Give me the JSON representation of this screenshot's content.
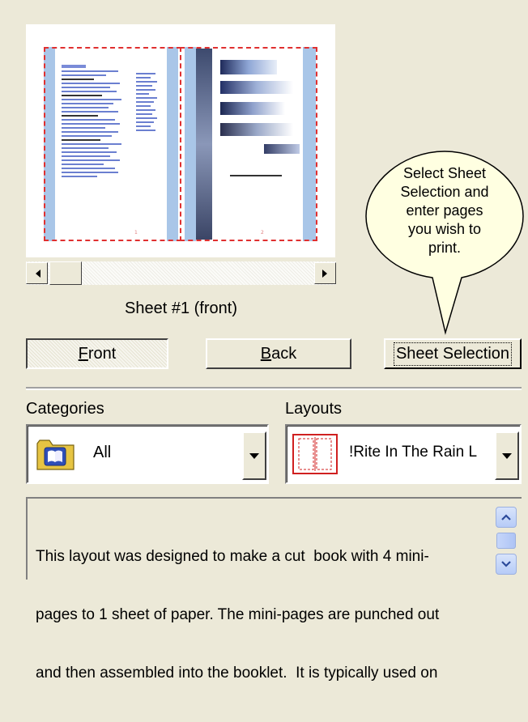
{
  "preview": {
    "left_page_number": "1",
    "right_page_number": "2"
  },
  "sheet_label": "Sheet #1 (front)",
  "buttons": {
    "front_label": "Front",
    "front_accel": "F",
    "front_rest": "ront",
    "back_label": "Back",
    "back_accel": "B",
    "back_rest": "ack",
    "sheet_selection_label": "Sheet Selection"
  },
  "tooltip": {
    "lines": [
      "Select Sheet",
      "Selection and",
      "enter pages",
      "you wish to",
      "print."
    ]
  },
  "categories": {
    "label": "Categories",
    "selected": "All",
    "icon": "book-folder-icon"
  },
  "layouts": {
    "label": "Layouts",
    "selected": "!Rite In The Rain L",
    "icon": "booklet-layout-icon"
  },
  "description": {
    "lines": [
      "This layout was designed to make a cut  book with 4 mini-",
      "pages to 1 sheet of paper. The mini-pages are punched out",
      "and then assembled into the booklet.  It is typically used on"
    ]
  },
  "colors": {
    "dialog_bg": "#ece9d8",
    "dash_red": "#e03030",
    "strip_blue": "#a9c6e8",
    "tooltip_bg": "#ffffe1"
  }
}
